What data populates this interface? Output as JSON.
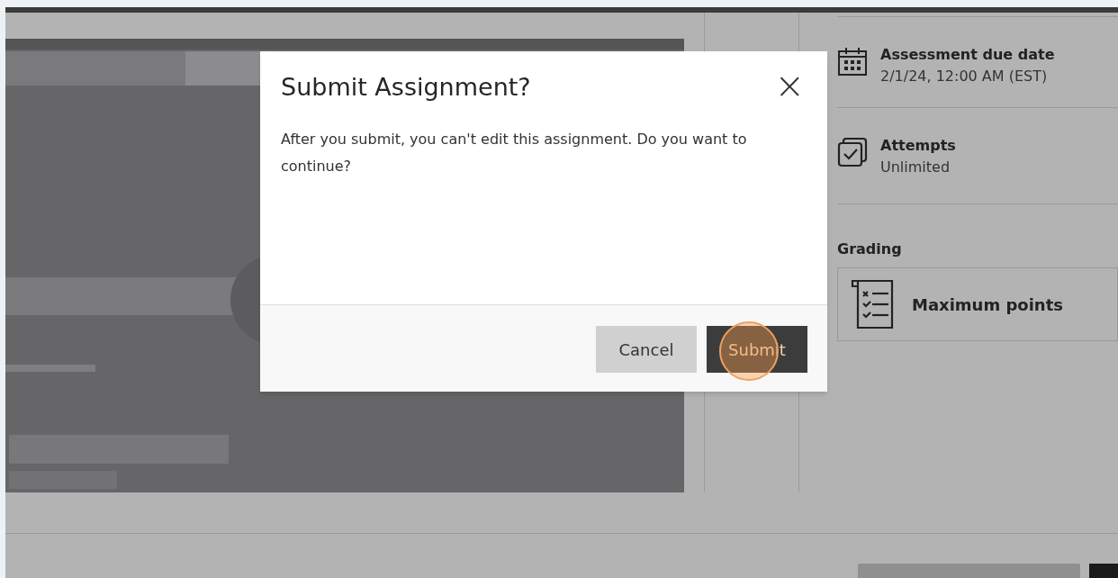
{
  "details": [
    {
      "kind": "calendar",
      "label": "Assessment due date",
      "value": "2/1/24, 12:00 AM (EST)"
    },
    {
      "kind": "attempts",
      "label": "Attempts",
      "value": "Unlimited"
    }
  ],
  "grading": {
    "heading": "Grading",
    "item": "Maximum points"
  },
  "dialog": {
    "title": "Submit Assignment?",
    "close": "×",
    "message": "After you submit, you can't edit this assignment. Do you want to continue?",
    "buttons": [
      {
        "label": "Cancel",
        "kind": "secondary"
      },
      {
        "label": "Submit",
        "kind": "primary",
        "highlighted": true
      }
    ]
  }
}
